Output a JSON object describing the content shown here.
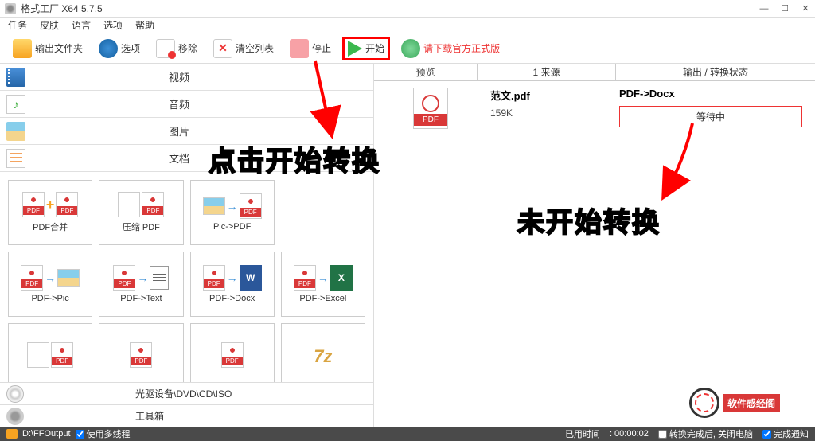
{
  "title": "格式工厂 X64 5.7.5",
  "menu": [
    "任务",
    "皮肤",
    "语言",
    "选项",
    "帮助"
  ],
  "toolbar": {
    "output": "输出文件夹",
    "options": "选项",
    "remove": "移除",
    "clear": "清空列表",
    "stop": "停止",
    "start": "开始",
    "download": "请下载官方正式版"
  },
  "categories": {
    "video": "视频",
    "audio": "音频",
    "image": "图片",
    "document": "文档"
  },
  "tiles": [
    "PDF合并",
    "压缩 PDF",
    "Pic->PDF",
    "",
    "PDF->Pic",
    "PDF->Text",
    "PDF->Docx",
    "PDF->Excel"
  ],
  "drive": "光驱设备\\DVD\\CD\\ISO",
  "toolbox": "工具箱",
  "right_header": [
    "预览",
    "1 来源",
    "输出 / 转换状态"
  ],
  "task": {
    "name": "范文.pdf",
    "size": "159K",
    "conversion": "PDF->Docx",
    "status": "等待中"
  },
  "annotations": {
    "a1": "点击开始转换",
    "a2": "未开始转换"
  },
  "watermark": "软件感经阁",
  "statusbar": {
    "path": "D:\\FFOutput",
    "multithread": "使用多线程",
    "elapsed": "已用时间",
    "time": ": 00:00:02",
    "after": "转换完成后, 关闭电脑",
    "notify": "完成通知"
  }
}
